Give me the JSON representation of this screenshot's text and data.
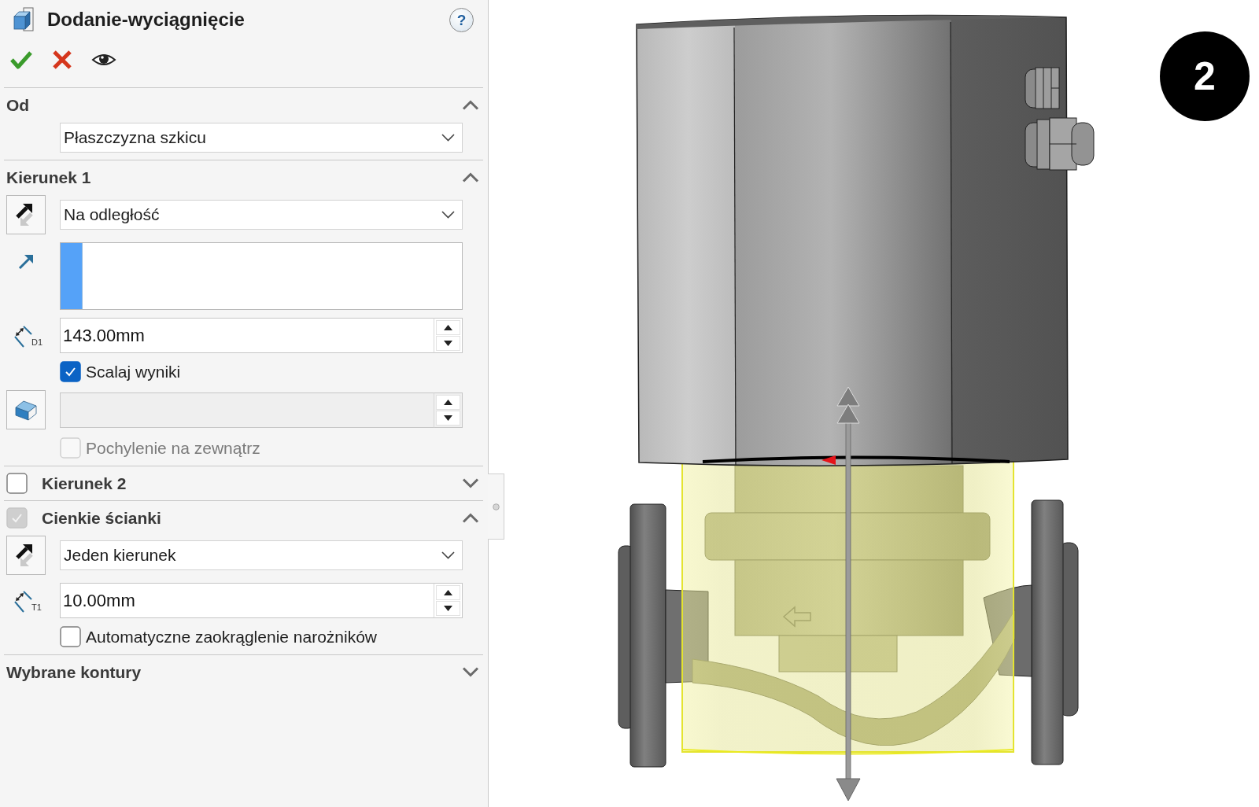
{
  "feature": {
    "title": "Dodanie-wyciągnięcie",
    "help": "?"
  },
  "actions": [
    {
      "kind": "ok"
    },
    {
      "kind": "cancel"
    },
    {
      "kind": "preview"
    }
  ],
  "sections": [
    {
      "title": "Od",
      "kind": "plain",
      "expanded": true,
      "controls": [
        {
          "kind": "dropdown",
          "value": "Płaszczyzna szkicu"
        }
      ]
    },
    {
      "title": "Kierunek 1",
      "kind": "plain",
      "expanded": true,
      "controls": [
        {
          "kind": "reverse-dropdown",
          "value": "Na odległość"
        },
        {
          "kind": "selection-box",
          "active": true
        },
        {
          "kind": "spin",
          "icon_label": "D1",
          "value": "143.00mm",
          "disabled": false
        },
        {
          "kind": "checkbox",
          "label": "Scalaj wyniki",
          "checked": true,
          "disabled": false
        },
        {
          "kind": "draft-spin",
          "disabled": true
        },
        {
          "kind": "checkbox",
          "label": "Pochylenie na zewnątrz",
          "checked": false,
          "disabled": true
        }
      ]
    },
    {
      "title": "Kierunek 2",
      "kind": "toggle",
      "checked": false,
      "disabled": false,
      "expanded": false
    },
    {
      "title": "Cienkie ścianki",
      "kind": "toggle",
      "checked": true,
      "disabled": true,
      "expanded": true,
      "controls": [
        {
          "kind": "reverse-dropdown",
          "value": "Jeden kierunek"
        },
        {
          "kind": "spin",
          "icon_label": "T1",
          "value": "10.00mm",
          "disabled": false
        },
        {
          "kind": "checkbox",
          "label": "Automatyczne zaokrąglenie narożników",
          "checked": false,
          "disabled": false
        }
      ]
    },
    {
      "title": "Wybrane kontury",
      "kind": "plain",
      "expanded": false
    }
  ],
  "viewport": {
    "step_marker": "2"
  }
}
